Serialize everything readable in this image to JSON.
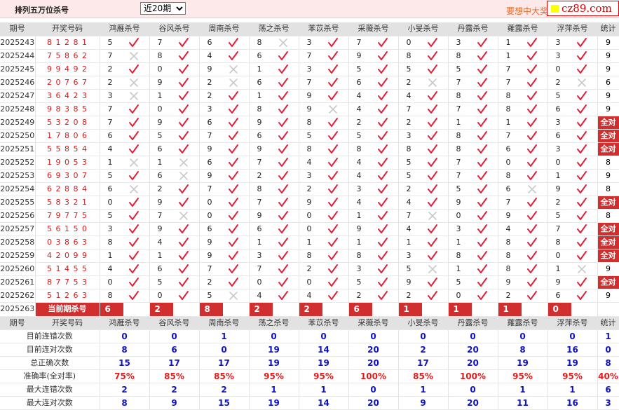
{
  "header": {
    "title": "排列五万位杀号",
    "period_options": [
      "近20期"
    ],
    "period_selected": "近20期",
    "banner_text": "要想中大奖",
    "logo": "cz89.com"
  },
  "columns": [
    "期号",
    "开奖号码",
    "鸿雁杀号",
    "谷风杀号",
    "周南杀号",
    "荡之杀号",
    "苯苡杀号",
    "采薇杀号",
    "小旻杀号",
    "丹露杀号",
    "蕹露杀号",
    "浮萍杀号",
    "统计"
  ],
  "rows": [
    {
      "id": "2025243",
      "draw": "81281",
      "kills": [
        5,
        7,
        6,
        8,
        3,
        7,
        0,
        3,
        1,
        3
      ],
      "marks": [
        1,
        1,
        1,
        0,
        1,
        1,
        1,
        1,
        1,
        1
      ],
      "stat": "9"
    },
    {
      "id": "2025244",
      "draw": "75862",
      "kills": [
        7,
        8,
        4,
        6,
        7,
        9,
        8,
        8,
        1,
        3
      ],
      "marks": [
        0,
        1,
        1,
        1,
        1,
        1,
        1,
        1,
        1,
        1
      ],
      "stat": "9"
    },
    {
      "id": "2025245",
      "draw": "99492",
      "kills": [
        2,
        0,
        9,
        1,
        3,
        5,
        5,
        5,
        7,
        0
      ],
      "marks": [
        1,
        1,
        0,
        1,
        1,
        1,
        1,
        1,
        1,
        1
      ],
      "stat": "9"
    },
    {
      "id": "2025246",
      "draw": "20767",
      "kills": [
        2,
        9,
        2,
        6,
        7,
        6,
        2,
        7,
        7,
        2
      ],
      "marks": [
        0,
        1,
        0,
        1,
        1,
        1,
        0,
        1,
        1,
        0
      ],
      "stat": "6"
    },
    {
      "id": "2025247",
      "draw": "36423",
      "kills": [
        3,
        1,
        2,
        1,
        9,
        4,
        4,
        8,
        8,
        5
      ],
      "marks": [
        0,
        1,
        1,
        1,
        1,
        1,
        1,
        1,
        1,
        1
      ],
      "stat": "9"
    },
    {
      "id": "2025248",
      "draw": "98385",
      "kills": [
        7,
        0,
        3,
        8,
        9,
        4,
        7,
        7,
        8,
        6
      ],
      "marks": [
        1,
        1,
        1,
        1,
        0,
        1,
        1,
        1,
        1,
        1
      ],
      "stat": "9"
    },
    {
      "id": "2025249",
      "draw": "53208",
      "kills": [
        7,
        9,
        6,
        9,
        8,
        2,
        2,
        1,
        1,
        3
      ],
      "marks": [
        1,
        1,
        1,
        1,
        1,
        1,
        1,
        1,
        1,
        1
      ],
      "stat": "全对"
    },
    {
      "id": "2025250",
      "draw": "17806",
      "kills": [
        6,
        5,
        7,
        6,
        5,
        5,
        3,
        8,
        7,
        6
      ],
      "marks": [
        1,
        1,
        1,
        1,
        1,
        1,
        1,
        1,
        1,
        1
      ],
      "stat": "全对"
    },
    {
      "id": "2025251",
      "draw": "55854",
      "kills": [
        4,
        6,
        9,
        9,
        8,
        8,
        8,
        8,
        6,
        3
      ],
      "marks": [
        1,
        1,
        1,
        1,
        1,
        1,
        1,
        1,
        1,
        1
      ],
      "stat": "全对"
    },
    {
      "id": "2025252",
      "draw": "19053",
      "kills": [
        1,
        1,
        6,
        7,
        4,
        4,
        5,
        7,
        0,
        0
      ],
      "marks": [
        0,
        0,
        1,
        1,
        1,
        1,
        1,
        1,
        1,
        1
      ],
      "stat": "8"
    },
    {
      "id": "2025253",
      "draw": "69307",
      "kills": [
        5,
        6,
        9,
        2,
        3,
        4,
        5,
        7,
        8,
        1
      ],
      "marks": [
        1,
        0,
        1,
        1,
        1,
        1,
        1,
        1,
        1,
        1
      ],
      "stat": "9"
    },
    {
      "id": "2025254",
      "draw": "62884",
      "kills": [
        6,
        2,
        7,
        8,
        2,
        3,
        2,
        5,
        6,
        9
      ],
      "marks": [
        0,
        1,
        1,
        1,
        1,
        1,
        1,
        1,
        0,
        1
      ],
      "stat": "8"
    },
    {
      "id": "2025255",
      "draw": "58321",
      "kills": [
        0,
        9,
        0,
        7,
        9,
        4,
        4,
        9,
        7,
        2
      ],
      "marks": [
        1,
        1,
        1,
        1,
        1,
        1,
        1,
        1,
        1,
        1
      ],
      "stat": "全对"
    },
    {
      "id": "2025256",
      "draw": "79775",
      "kills": [
        5,
        7,
        0,
        9,
        0,
        1,
        7,
        0,
        9,
        5
      ],
      "marks": [
        1,
        0,
        1,
        1,
        1,
        1,
        0,
        1,
        1,
        1
      ],
      "stat": "8"
    },
    {
      "id": "2025257",
      "draw": "56150",
      "kills": [
        3,
        9,
        6,
        6,
        0,
        9,
        4,
        3,
        4,
        7
      ],
      "marks": [
        1,
        1,
        1,
        1,
        1,
        1,
        1,
        1,
        1,
        1
      ],
      "stat": "全对"
    },
    {
      "id": "2025258",
      "draw": "03863",
      "kills": [
        8,
        4,
        9,
        1,
        1,
        1,
        1,
        1,
        8,
        8
      ],
      "marks": [
        1,
        1,
        1,
        1,
        1,
        1,
        1,
        1,
        1,
        1
      ],
      "stat": "全对"
    },
    {
      "id": "2025259",
      "draw": "42099",
      "kills": [
        1,
        1,
        9,
        3,
        8,
        8,
        3,
        8,
        8,
        0
      ],
      "marks": [
        1,
        1,
        1,
        1,
        1,
        1,
        1,
        1,
        1,
        1
      ],
      "stat": "全对"
    },
    {
      "id": "2025260",
      "draw": "51455",
      "kills": [
        4,
        6,
        7,
        7,
        2,
        3,
        5,
        1,
        8,
        1
      ],
      "marks": [
        1,
        1,
        1,
        1,
        1,
        1,
        0,
        1,
        1,
        0
      ],
      "stat": "9"
    },
    {
      "id": "2025261",
      "draw": "87753",
      "kills": [
        0,
        5,
        2,
        0,
        0,
        5,
        9,
        5,
        9,
        9
      ],
      "marks": [
        1,
        1,
        1,
        1,
        1,
        1,
        1,
        1,
        1,
        1
      ],
      "stat": "全对"
    },
    {
      "id": "2025262",
      "draw": "51263",
      "kills": [
        8,
        0,
        5,
        4,
        4,
        2,
        2,
        0,
        2,
        6
      ],
      "marks": [
        1,
        1,
        0,
        1,
        1,
        1,
        1,
        1,
        1,
        1
      ],
      "stat": "9"
    }
  ],
  "current": {
    "id": "2025263",
    "label": "当前期杀号",
    "kills": [
      "6",
      "2",
      "8",
      "2",
      "2",
      "6",
      "1",
      "1",
      "1",
      "0"
    ]
  },
  "summary_header": [
    "期号",
    "开奖号码",
    "鸿雁杀号",
    "谷风杀号",
    "周南杀号",
    "荡之杀号",
    "苯苡杀号",
    "采薇杀号",
    "小旻杀号",
    "丹露杀号",
    "蕹露杀号",
    "浮萍杀号",
    "统计"
  ],
  "stats": [
    {
      "label": "目前连错次数",
      "values": [
        "0",
        "0",
        "1",
        "0",
        "0",
        "0",
        "0",
        "0",
        "0",
        "0",
        "1"
      ],
      "type": "v"
    },
    {
      "label": "目前连对次数",
      "values": [
        "8",
        "6",
        "0",
        "19",
        "14",
        "20",
        "2",
        "20",
        "8",
        "16",
        "0"
      ],
      "type": "v"
    },
    {
      "label": "总正确次数",
      "values": [
        "15",
        "17",
        "17",
        "19",
        "19",
        "20",
        "17",
        "20",
        "19",
        "19",
        "8"
      ],
      "type": "v"
    },
    {
      "label": "准确率(全对率)",
      "values": [
        "75%",
        "85%",
        "85%",
        "95%",
        "95%",
        "100%",
        "85%",
        "100%",
        "95%",
        "95%",
        "40%"
      ],
      "type": "p"
    },
    {
      "label": "最大连错次数",
      "values": [
        "2",
        "2",
        "2",
        "1",
        "1",
        "0",
        "1",
        "0",
        "1",
        "1",
        "6"
      ],
      "type": "v"
    },
    {
      "label": "最大连对次数",
      "values": [
        "8",
        "9",
        "15",
        "19",
        "14",
        "20",
        "9",
        "20",
        "11",
        "16",
        "3"
      ],
      "type": "v"
    }
  ],
  "colors": {
    "hit": "#e0203a",
    "miss": "#c9c9c9",
    "accent": "#d12f2f",
    "stat_value": "#0e12c8"
  }
}
